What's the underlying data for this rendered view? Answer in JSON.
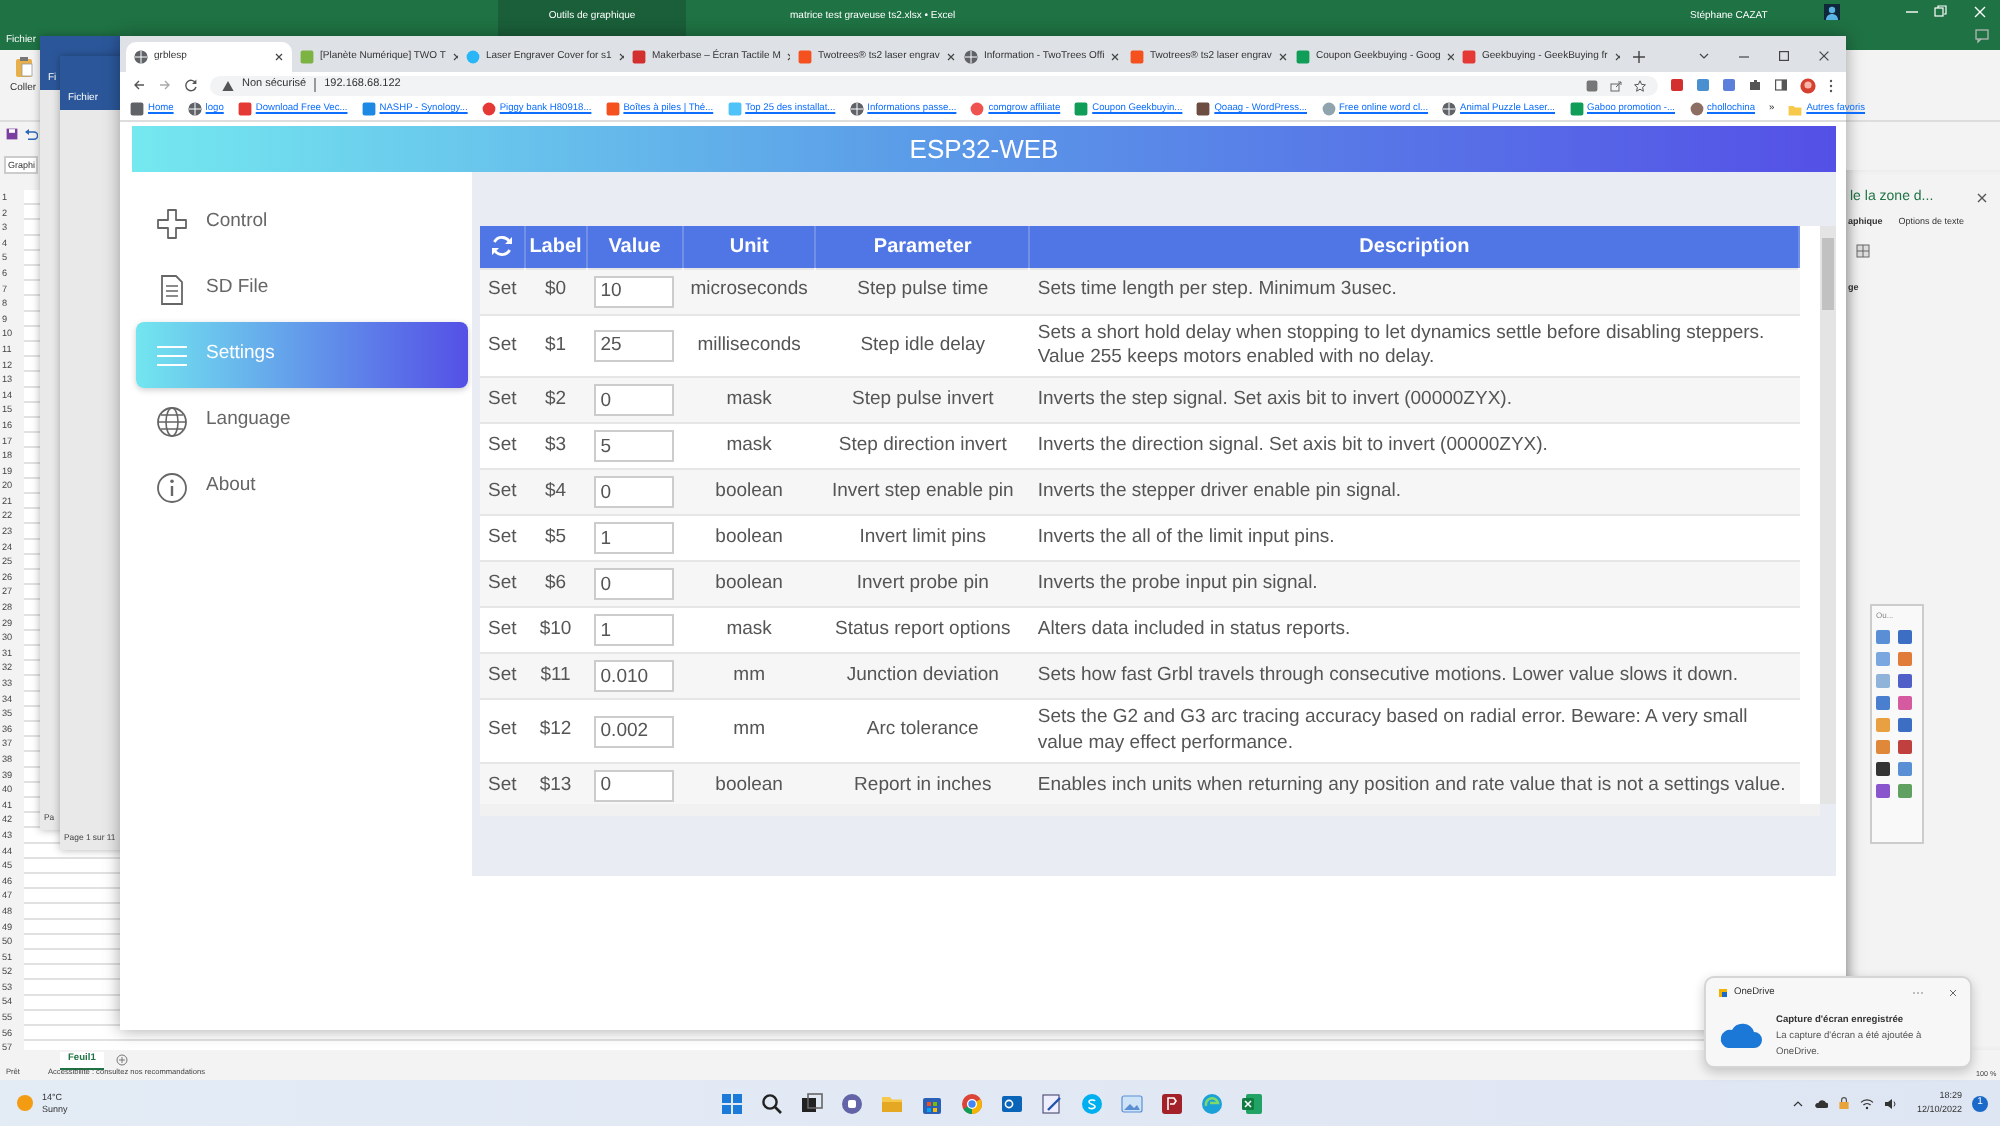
{
  "excel": {
    "context_tab": "Outils de graphique",
    "title": "matrice test graveuse ts2.xlsx • Excel",
    "user": "Stéphane CAZAT",
    "file_menu": "Fichier",
    "paste": "Coller",
    "name_box": "Graphi",
    "rows": [
      "1",
      "2",
      "3",
      "4",
      "5",
      "6",
      "7",
      "8",
      "9",
      "10",
      "11",
      "12",
      "13",
      "14",
      "15",
      "16",
      "17",
      "18",
      "19",
      "20",
      "21",
      "22",
      "23",
      "24",
      "25",
      "26",
      "27",
      "28",
      "29",
      "30",
      "31",
      "32",
      "33",
      "34",
      "35",
      "36",
      "37",
      "38",
      "39",
      "40",
      "41",
      "42",
      "43",
      "44",
      "45",
      "46",
      "47",
      "48",
      "49",
      "50",
      "51",
      "52",
      "53",
      "54",
      "55",
      "56",
      "57"
    ],
    "sheet_tabs": [
      {
        "label": "Feuil1",
        "selected": true
      }
    ],
    "status": "Prêt",
    "accessibility": "Accessibilité : consultez nos recommandations",
    "zoom": "100 %",
    "pane": {
      "title": "le la zone d...",
      "tabs": [
        {
          "label": "aphique",
          "selected": true
        },
        {
          "label": "Options de texte",
          "selected": false
        }
      ],
      "section": "ge"
    },
    "palette": {
      "title": "Ou..."
    }
  },
  "doc_windows": [
    {
      "menu": "Fi",
      "status": "Pa"
    },
    {
      "menu": "Fichier",
      "status": "Page 1 sur 11"
    }
  ],
  "browser": {
    "tabs": [
      {
        "title": "grblesp",
        "selected": true,
        "kind": "globe",
        "color": "#5f6368"
      },
      {
        "title": "[Planète Numérique] TWO T",
        "selected": false,
        "kind": "square",
        "color": "#7cb342"
      },
      {
        "title": "Laser Engraver Cover for s1",
        "selected": false,
        "kind": "circle",
        "color": "#29b6f6"
      },
      {
        "title": "Makerbase – Écran Tactile M",
        "selected": false,
        "kind": "square",
        "color": "#d32f2f"
      },
      {
        "title": "Twotrees® ts2 laser engrav",
        "selected": false,
        "kind": "square",
        "color": "#f4511e"
      },
      {
        "title": "Information - TwoTrees Offi",
        "selected": false,
        "kind": "globe",
        "color": "#5f6368"
      },
      {
        "title": "Twotrees® ts2 laser engrav",
        "selected": false,
        "kind": "square",
        "color": "#f4511e"
      },
      {
        "title": "Coupon Geekbuying - Goog",
        "selected": false,
        "kind": "square",
        "color": "#0f9d58"
      },
      {
        "title": "Geekbuying - GeekBuying fr",
        "selected": false,
        "kind": "square",
        "color": "#e53935"
      }
    ],
    "address": {
      "security": "Non sécurisé",
      "url": "192.168.68.122"
    },
    "bookmarks": [
      {
        "label": "Home",
        "kind": "square",
        "color": "#5f6368"
      },
      {
        "label": "logo",
        "kind": "globe",
        "color": "#5f6368"
      },
      {
        "label": "Download Free Vec...",
        "kind": "square",
        "color": "#e53935"
      },
      {
        "label": "NASHP - Synology...",
        "kind": "square",
        "color": "#1e88e5"
      },
      {
        "label": "Piggy bank H80918...",
        "kind": "circle",
        "color": "#e53935"
      },
      {
        "label": "Boîtes à piles | Thé...",
        "kind": "square",
        "color": "#f4511e"
      },
      {
        "label": "Top 25 des installat...",
        "kind": "square",
        "color": "#4fc3f7"
      },
      {
        "label": "Informations passe...",
        "kind": "globe",
        "color": "#5f6368"
      },
      {
        "label": "comgrow affiliate",
        "kind": "circle",
        "color": "#ef5350"
      },
      {
        "label": "Coupon Geekbuyin...",
        "kind": "square",
        "color": "#0f9d58"
      },
      {
        "label": "Qoaag - WordPress...",
        "kind": "square",
        "color": "#6d4c41"
      },
      {
        "label": "Free online word cl...",
        "kind": "circle",
        "color": "#90a4ae"
      },
      {
        "label": "Animal Puzzle Laser...",
        "kind": "globe",
        "color": "#5f6368"
      },
      {
        "label": "Gaboo promotion -...",
        "kind": "square",
        "color": "#0f9d58"
      },
      {
        "label": "chollochina",
        "kind": "circle",
        "color": "#8d6e63"
      }
    ],
    "more": "»",
    "other": "Autres favoris"
  },
  "app": {
    "brand": "ESP32-WEB",
    "nav": [
      {
        "label": "Control",
        "kind": "control",
        "selected": false
      },
      {
        "label": "SD File",
        "kind": "file",
        "selected": false
      },
      {
        "label": "Settings",
        "kind": "menu",
        "selected": true
      },
      {
        "label": "Language",
        "kind": "globe",
        "selected": false
      },
      {
        "label": "About",
        "kind": "info",
        "selected": false
      }
    ],
    "columns": [
      "Label",
      "Value",
      "Unit",
      "Parameter",
      "Description"
    ],
    "rows": [
      {
        "action": "Set",
        "label": "$0",
        "value": "10",
        "unit": "microseconds",
        "parameter": "Step pulse time",
        "description": "Sets time length per step. Minimum 3usec."
      },
      {
        "action": "Set",
        "label": "$1",
        "value": "25",
        "unit": "milliseconds",
        "parameter": "Step idle delay",
        "description": "Sets a short hold delay when stopping to let dynamics settle before disabling steppers. Value 255 keeps motors enabled with no delay."
      },
      {
        "action": "Set",
        "label": "$2",
        "value": "0",
        "unit": "mask",
        "parameter": "Step pulse invert",
        "description": "Inverts the step signal. Set axis bit to invert (00000ZYX)."
      },
      {
        "action": "Set",
        "label": "$3",
        "value": "5",
        "unit": "mask",
        "parameter": "Step direction invert",
        "description": "Inverts the direction signal. Set axis bit to invert (00000ZYX)."
      },
      {
        "action": "Set",
        "label": "$4",
        "value": "0",
        "unit": "boolean",
        "parameter": "Invert step enable pin",
        "description": "Inverts the stepper driver enable pin signal."
      },
      {
        "action": "Set",
        "label": "$5",
        "value": "1",
        "unit": "boolean",
        "parameter": "Invert limit pins",
        "description": "Inverts the all of the limit input pins."
      },
      {
        "action": "Set",
        "label": "$6",
        "value": "0",
        "unit": "boolean",
        "parameter": "Invert probe pin",
        "description": "Inverts the probe input pin signal."
      },
      {
        "action": "Set",
        "label": "$10",
        "value": "1",
        "unit": "mask",
        "parameter": "Status report options",
        "description": "Alters data included in status reports."
      },
      {
        "action": "Set",
        "label": "$11",
        "value": "0.010",
        "unit": "mm",
        "parameter": "Junction deviation",
        "description": "Sets how fast Grbl travels through consecutive motions. Lower value slows it down."
      },
      {
        "action": "Set",
        "label": "$12",
        "value": "0.002",
        "unit": "mm",
        "parameter": "Arc tolerance",
        "description": "Sets the G2 and G3 arc tracing accuracy based on radial error. Beware: A very small value may effect performance."
      },
      {
        "action": "Set",
        "label": "$13",
        "value": "0",
        "unit": "boolean",
        "parameter": "Report in inches",
        "description": "Enables inch units when returning any position and rate value that is not a settings value."
      }
    ]
  },
  "notification": {
    "app": "OneDrive",
    "title": "Capture d'écran enregistrée",
    "body": "La capture d'écran a été ajoutée à OneDrive."
  },
  "taskbar": {
    "weather": {
      "temp": "14°C",
      "condition": "Sunny"
    },
    "apps": [
      {
        "kind": "start"
      },
      {
        "kind": "search"
      },
      {
        "kind": "taskview"
      },
      {
        "kind": "chat"
      },
      {
        "kind": "folder"
      },
      {
        "kind": "store"
      },
      {
        "kind": "chrome"
      },
      {
        "kind": "mail"
      },
      {
        "kind": "editor"
      },
      {
        "kind": "skype"
      },
      {
        "kind": "photos"
      },
      {
        "kind": "redapp"
      },
      {
        "kind": "edge"
      },
      {
        "kind": "excel"
      }
    ],
    "time": "18:29",
    "date": "12/10/2022",
    "badge": "1"
  }
}
